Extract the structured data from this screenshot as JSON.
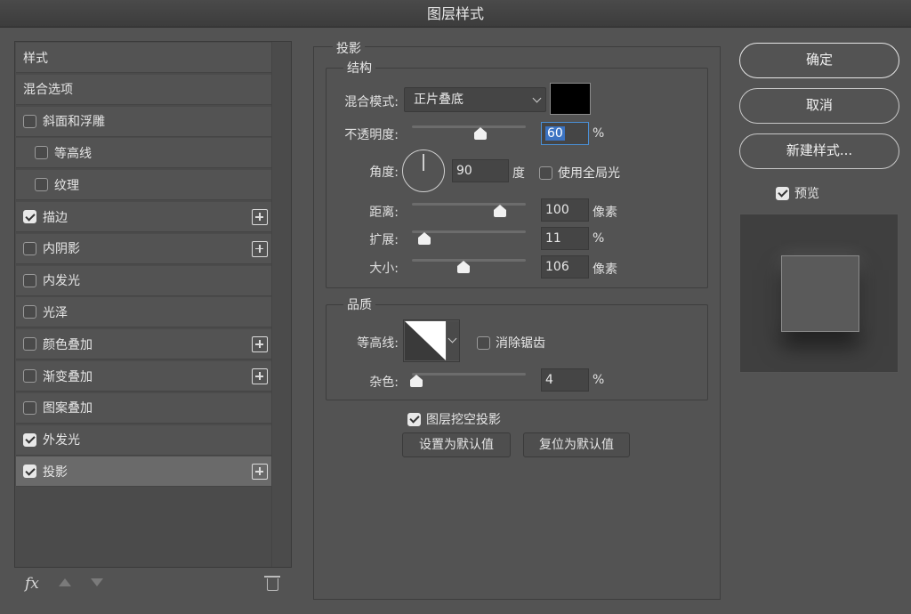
{
  "window": {
    "title": "图层样式"
  },
  "style_list": {
    "items": [
      {
        "label": "样式",
        "has_checkbox": false,
        "checked": false,
        "has_plus": false,
        "indent": false,
        "selected": false
      },
      {
        "label": "混合选项",
        "has_checkbox": false,
        "checked": false,
        "has_plus": false,
        "indent": false,
        "selected": false
      },
      {
        "label": "斜面和浮雕",
        "has_checkbox": true,
        "checked": false,
        "has_plus": false,
        "indent": false,
        "selected": false
      },
      {
        "label": "等高线",
        "has_checkbox": true,
        "checked": false,
        "has_plus": false,
        "indent": true,
        "selected": false
      },
      {
        "label": "纹理",
        "has_checkbox": true,
        "checked": false,
        "has_plus": false,
        "indent": true,
        "selected": false
      },
      {
        "label": "描边",
        "has_checkbox": true,
        "checked": true,
        "has_plus": true,
        "indent": false,
        "selected": false
      },
      {
        "label": "内阴影",
        "has_checkbox": true,
        "checked": false,
        "has_plus": true,
        "indent": false,
        "selected": false
      },
      {
        "label": "内发光",
        "has_checkbox": true,
        "checked": false,
        "has_plus": false,
        "indent": false,
        "selected": false
      },
      {
        "label": "光泽",
        "has_checkbox": true,
        "checked": false,
        "has_plus": false,
        "indent": false,
        "selected": false
      },
      {
        "label": "颜色叠加",
        "has_checkbox": true,
        "checked": false,
        "has_plus": true,
        "indent": false,
        "selected": false
      },
      {
        "label": "渐变叠加",
        "has_checkbox": true,
        "checked": false,
        "has_plus": true,
        "indent": false,
        "selected": false
      },
      {
        "label": "图案叠加",
        "has_checkbox": true,
        "checked": false,
        "has_plus": false,
        "indent": false,
        "selected": false
      },
      {
        "label": "外发光",
        "has_checkbox": true,
        "checked": true,
        "has_plus": false,
        "indent": false,
        "selected": false
      },
      {
        "label": "投影",
        "has_checkbox": true,
        "checked": true,
        "has_plus": true,
        "indent": false,
        "selected": true
      }
    ],
    "footer": {
      "fx_label": "fx"
    }
  },
  "drop_shadow": {
    "panel_title": "投影",
    "structure": {
      "title": "结构",
      "blend_mode_label": "混合模式:",
      "blend_mode_value": "正片叠底",
      "shadow_color": "#000000",
      "opacity_label": "不透明度:",
      "opacity_value": "60",
      "opacity_unit": "%",
      "opacity_level": 0.6,
      "angle_label": "角度:",
      "angle_value": "90",
      "angle_unit": "度",
      "use_global_light_label": "使用全局光",
      "use_global_light_checked": false,
      "distance_label": "距离:",
      "distance_value": "100",
      "distance_unit": "像素",
      "distance_level": 0.77,
      "spread_label": "扩展:",
      "spread_value": "11",
      "spread_unit": "%",
      "spread_level": 0.11,
      "size_label": "大小:",
      "size_value": "106",
      "size_unit": "像素",
      "size_level": 0.45
    },
    "quality": {
      "title": "品质",
      "contour_label": "等高线:",
      "anti_alias_label": "消除锯齿",
      "anti_alias_checked": false,
      "noise_label": "杂色:",
      "noise_value": "4",
      "noise_unit": "%",
      "noise_level": 0.04
    },
    "knockout_label": "图层挖空投影",
    "knockout_checked": true,
    "make_default_label": "设置为默认值",
    "reset_default_label": "复位为默认值"
  },
  "buttons": {
    "ok": "确定",
    "cancel": "取消",
    "new_style": "新建样式..."
  },
  "preview": {
    "label": "预览",
    "checked": true
  }
}
